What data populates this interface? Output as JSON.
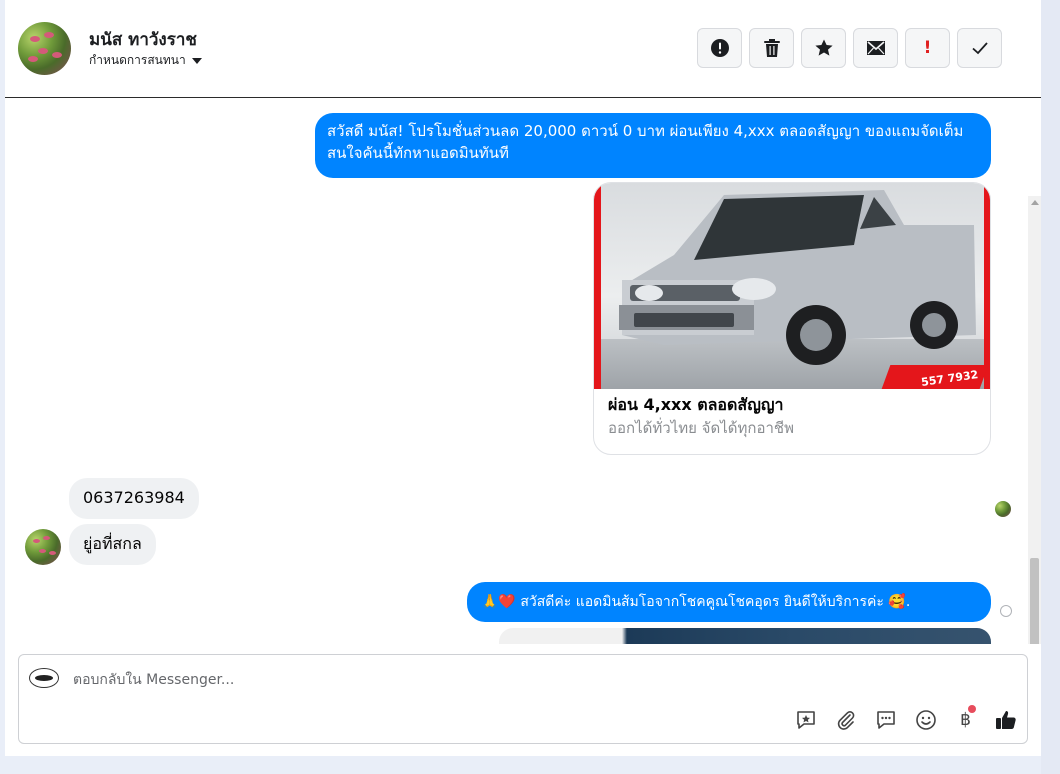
{
  "header": {
    "contact_name": "มนัส ทาวังราช",
    "conversation_setting": "กำหนดการสนทนา",
    "toolbar": [
      {
        "name": "report-button",
        "icon": "alert-circle-icon"
      },
      {
        "name": "delete-button",
        "icon": "trash-icon"
      },
      {
        "name": "star-button",
        "icon": "star-icon"
      },
      {
        "name": "mark-unread-button",
        "icon": "envelope-icon"
      },
      {
        "name": "important-button",
        "icon": "exclamation-icon"
      },
      {
        "name": "done-button",
        "icon": "check-icon"
      }
    ]
  },
  "messages": {
    "promo_text": "สวัสดี มนัส! โปรโมชั่นส่วนลด 20,000 ดาวน์ 0 บาท ผ่อนเพียง 4,xxx ตลอดสัญญา ของแถมจัดเต็ม สนใจคันนี้ทักหาแอดมินทันที",
    "card": {
      "title": "ผ่อน 4,xxx ตลอดสัญญา",
      "subtitle": "ออกได้ทั่วไทย จัดได้ทุกอาชีพ",
      "image_caption": "557 7932"
    },
    "incoming": [
      "0637263984",
      "ยู่อที่สกล"
    ],
    "reply_text": "🙏❤️ สวัสดีค่ะ แอดมินส้มโอจากโชคคูณโชคอุดร ยินดีให้บริการค่ะ 🥰."
  },
  "composer": {
    "placeholder": "ตอบกลับใน Messenger..."
  },
  "colors": {
    "outgoing_bubble": "#0084ff",
    "incoming_bubble": "#eff1f3",
    "notification_dot": "#e74c5c"
  }
}
